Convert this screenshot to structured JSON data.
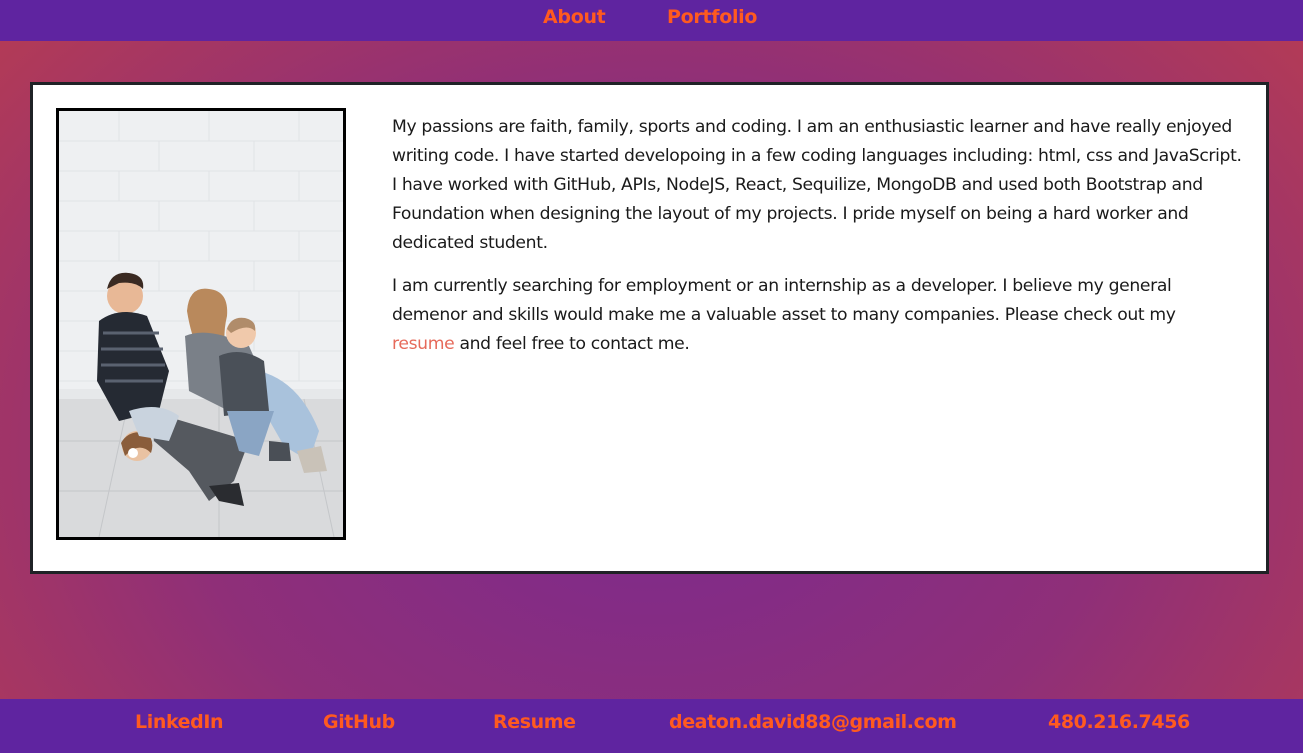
{
  "nav": {
    "about": "About",
    "portfolio": "Portfolio"
  },
  "bio": {
    "paragraph1": "My passions are faith, family, sports and coding. I am an enthusiastic learner and have really enjoyed writing code. I have started developoing in a few coding languages including: html, css and JavaScript. I have worked with GitHub, APIs, NodeJS, React, Sequilize, MongoDB and used both Bootstrap and Foundation when designing the layout of my projects. I pride myself on being a hard worker and dedicated student.",
    "paragraph2_before": "I am currently searching for employment or an internship as a developer. I believe my general demenor and skills would make me a valuable asset to many companies. Please check out my ",
    "resume_link": "resume",
    "paragraph2_after": " and feel free to contact me."
  },
  "footer": {
    "linkedin": "LinkedIn",
    "github": "GitHub",
    "resume": "Resume",
    "email": "deaton.david88@gmail.com",
    "phone": "480.216.7456"
  },
  "colors": {
    "nav_bg": "#5f24a0",
    "link": "#ff5a1f",
    "inline_link": "#e66a5a",
    "card_border": "#1f2226"
  }
}
